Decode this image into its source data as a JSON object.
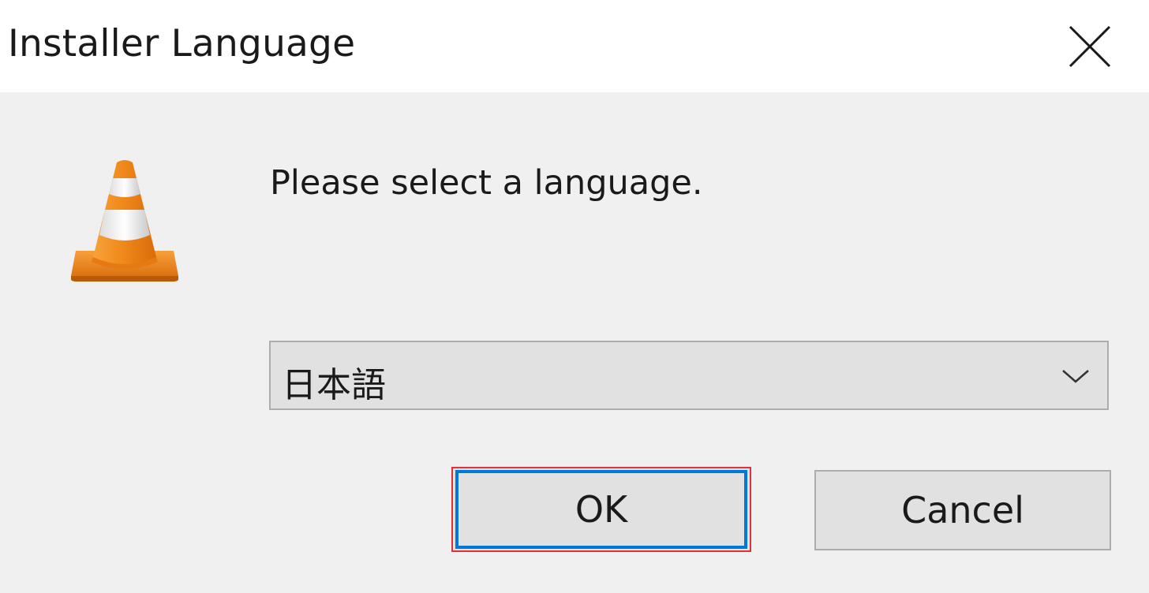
{
  "window": {
    "title": "Installer Language",
    "close_icon": "close-icon"
  },
  "dialog": {
    "app_icon": "vlc-cone-icon",
    "prompt": "Please select a language.",
    "language_select": {
      "selected": "日本語",
      "arrow_icon": "chevron-down-icon"
    },
    "ok_label": "OK",
    "cancel_label": "Cancel"
  },
  "colors": {
    "titlebar_bg": "#ffffff",
    "dialog_bg": "#f0f0f0",
    "button_bg": "#e1e1e1",
    "focus_border": "#0078d7",
    "highlight_border": "#e0323a",
    "cone_orange": "#f08a1c"
  }
}
